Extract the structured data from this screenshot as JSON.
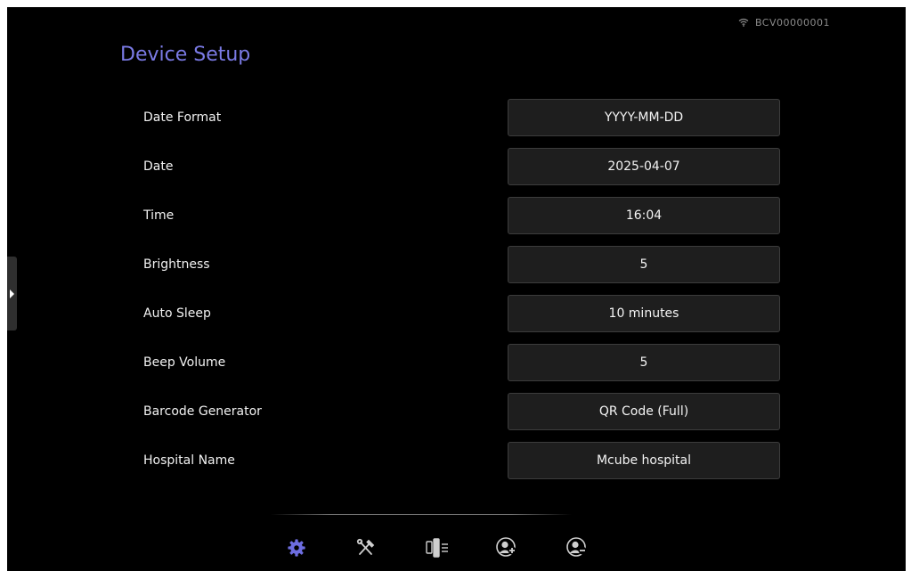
{
  "status": {
    "device_id": "BCV00000001",
    "wifi_icon": "wifi-icon"
  },
  "page": {
    "title": "Device Setup"
  },
  "settings": [
    {
      "label": "Date Format",
      "value": "YYYY-MM-DD"
    },
    {
      "label": "Date",
      "value": "2025-04-07"
    },
    {
      "label": "Time",
      "value": "16:04"
    },
    {
      "label": "Brightness",
      "value": "5"
    },
    {
      "label": "Auto Sleep",
      "value": "10 minutes"
    },
    {
      "label": "Beep Volume",
      "value": "5"
    },
    {
      "label": "Barcode Generator",
      "value": "QR Code (Full)"
    },
    {
      "label": "Hospital Name",
      "value": "Mcube hospital"
    }
  ],
  "toolbar": {
    "items": [
      {
        "icon": "gear-icon",
        "active": true
      },
      {
        "icon": "tools-icon",
        "active": false
      },
      {
        "icon": "probe-list-icon",
        "active": false
      },
      {
        "icon": "add-user-icon",
        "active": false
      },
      {
        "icon": "remove-user-icon",
        "active": false
      }
    ]
  },
  "colors": {
    "background": "#000000",
    "accent": "#7b7be6",
    "field_bg": "#1e1e1e",
    "field_border": "#3c3c3c",
    "text": "#f2f2f2",
    "status_text": "#8b8b8b",
    "icon_gray": "#d0d0d0"
  }
}
